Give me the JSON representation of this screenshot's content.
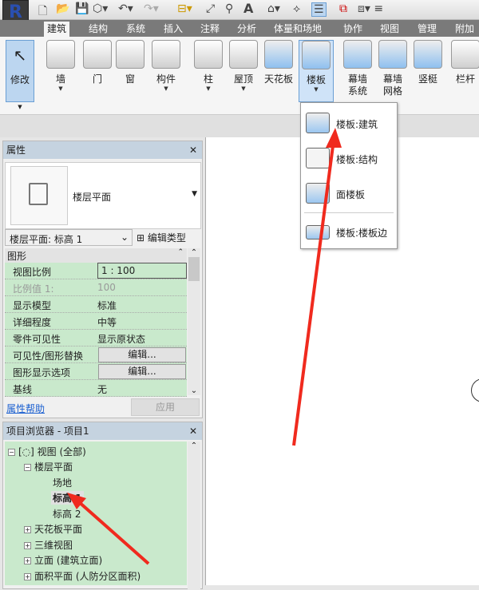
{
  "qat": {
    "logo": "R",
    "icons": [
      "new-icon",
      "open-icon",
      "save-icon",
      "sync-icon",
      "undo-icon",
      "redo-icon",
      "measure-icon",
      "dimension-icon",
      "tag-icon",
      "text-icon",
      "3d-view-icon",
      "section-icon",
      "thin-lines-icon",
      "close-hidden-icon",
      "switch-windows-icon"
    ],
    "text_glyph": "A"
  },
  "tabs": [
    "建筑",
    "结构",
    "系统",
    "插入",
    "注释",
    "分析",
    "体量和场地",
    "协作",
    "视图",
    "管理",
    "附加"
  ],
  "ribbon": {
    "modify": "修改",
    "buttons": [
      {
        "label": "墙",
        "dd": true
      },
      {
        "label": "门"
      },
      {
        "label": "窗"
      },
      {
        "label": "构件",
        "dd": true
      },
      {
        "label": "柱",
        "dd": true
      },
      {
        "label": "屋顶",
        "dd": true
      },
      {
        "label": "天花板"
      },
      {
        "label": "楼板",
        "dd": true
      },
      {
        "label": "幕墙\n系统"
      },
      {
        "label": "幕墙\n网格"
      },
      {
        "label": "竖梃"
      },
      {
        "label": "栏杆"
      }
    ]
  },
  "floor_menu": [
    "楼板:建筑",
    "楼板:结构",
    "面楼板",
    "楼板:楼板边"
  ],
  "properties": {
    "title": "属性",
    "close": "✕",
    "type_name": "楼层平面",
    "selector": "楼层平面: 标高 1",
    "edit_type": "编辑类型",
    "group": "图形",
    "rows": [
      {
        "k": "视图比例",
        "v": "1 : 100"
      },
      {
        "k": "比例值 1:",
        "v": "100"
      },
      {
        "k": "显示模型",
        "v": "标准"
      },
      {
        "k": "详细程度",
        "v": "中等"
      },
      {
        "k": "零件可见性",
        "v": "显示原状态"
      },
      {
        "k": "可见性/图形替换",
        "v": "编辑..."
      },
      {
        "k": "图形显示选项",
        "v": "编辑..."
      },
      {
        "k": "基线",
        "v": "无"
      }
    ],
    "help": "属性帮助",
    "apply": "应用"
  },
  "browser": {
    "title": "项目浏览器 - 项目1",
    "close": "✕",
    "items": [
      "视图 (全部)",
      "楼层平面",
      "场地",
      "标高 1",
      "标高 2",
      "天花板平面",
      "三维视图",
      "立面 (建筑立面)",
      "面积平面 (人防分区面积)"
    ]
  },
  "colors": {
    "accent": "#3b8ee0",
    "green": "#c9e9cc",
    "arrow": "#f02a1e"
  }
}
